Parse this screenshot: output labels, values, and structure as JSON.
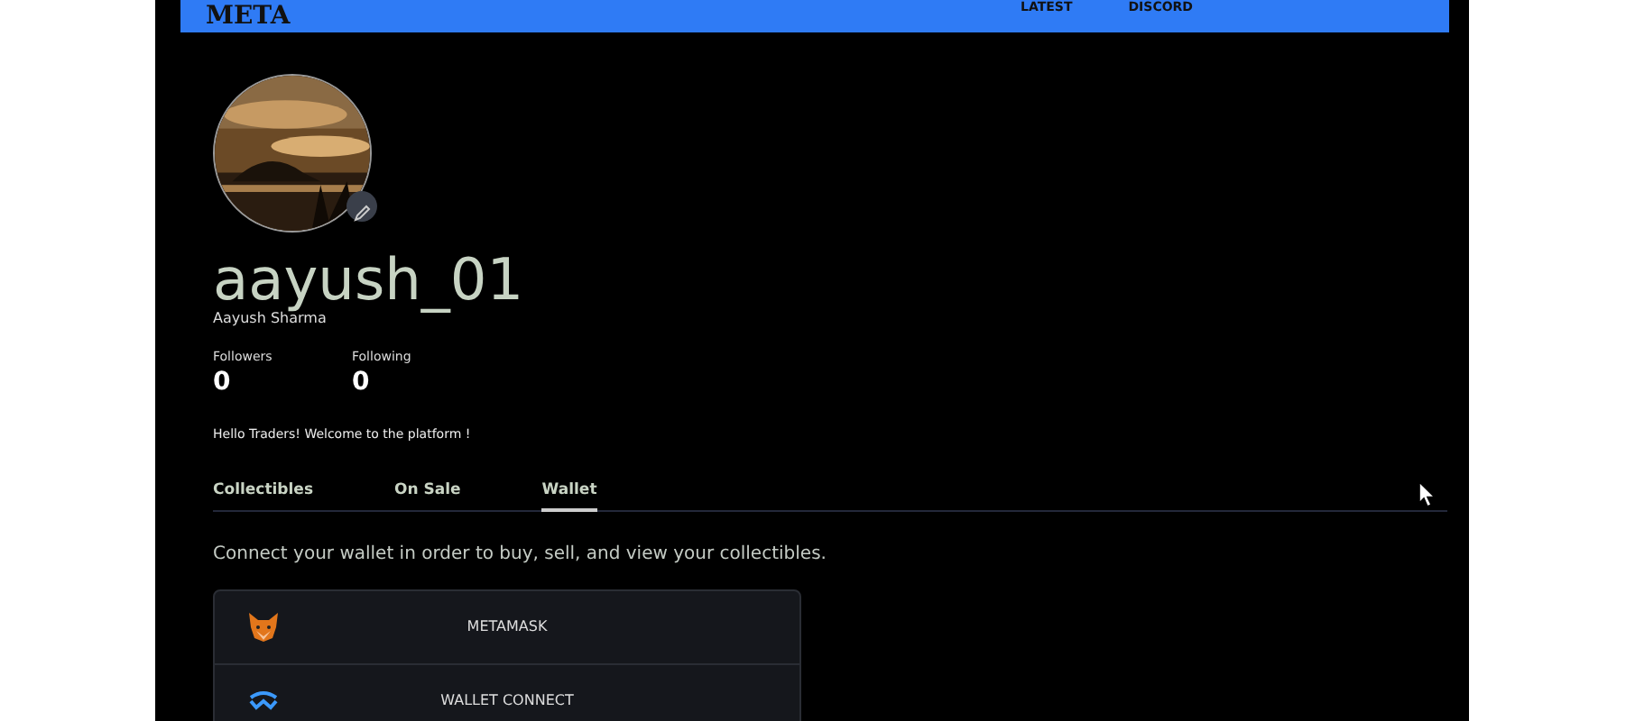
{
  "navbar": {
    "logo": "META",
    "links": [
      "LATEST",
      "DISCORD"
    ]
  },
  "profile": {
    "avatar": {
      "kind": "picture",
      "editable": true
    },
    "username": "aayush_01",
    "full_name": "Aayush Sharma",
    "stats": [
      {
        "label": "Followers",
        "value": "0"
      },
      {
        "label": "Following",
        "value": "0"
      }
    ],
    "bio": "Hello Traders! Welcome to the platform !"
  },
  "tabs": [
    {
      "label": "Collectibles",
      "selected": false
    },
    {
      "label": "On Sale",
      "selected": false
    },
    {
      "label": "Wallet",
      "selected": true
    }
  ],
  "wallet": {
    "intro": "Connect your wallet in order to buy, sell, and view your collectibles.",
    "options": [
      {
        "kind": "fox",
        "label": "METAMASK"
      },
      {
        "kind": "wave",
        "label": "WALLET CONNECT"
      }
    ]
  }
}
